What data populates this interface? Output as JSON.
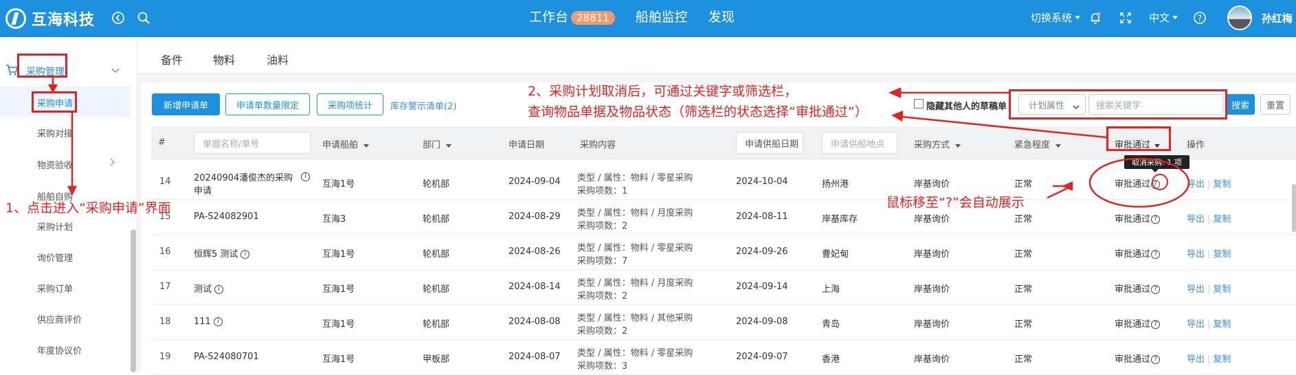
{
  "header": {
    "logo_text": "互海科技",
    "nav": {
      "workbench": "工作台",
      "workbench_badge": "28811",
      "ship_monitor": "船舶监控",
      "discover": "发现"
    },
    "switch_system": "切换系统",
    "language": "中文",
    "username": "孙红梅",
    "brand_color": "#1e90e0"
  },
  "sidebar": {
    "group_label": "采购管理",
    "items": [
      "采购申请",
      "采购对接",
      "物资验收",
      "船舶自购",
      "采购计划",
      "询价管理",
      "采购订单",
      "供应商评价",
      "年度协议价"
    ]
  },
  "tabs": [
    "备件",
    "物料",
    "油料"
  ],
  "active_tab": "物料",
  "toolbar": {
    "new_request": "新增申请单",
    "quantity_limit": "申请单数量限定",
    "item_stats": "采购项统计",
    "stock_alert_link": "库存警示清单(2)",
    "hide_drafts": "隐藏其他人的草稿单",
    "plan_attr_select": "计划属性",
    "search_placeholder": "搜索关键字",
    "search_btn": "搜索",
    "reset_btn": "重置"
  },
  "table": {
    "headers": {
      "index": "#",
      "name_placeholder": "单据名称/单号",
      "ship": "申请船舶",
      "dept": "部门",
      "date": "申请日期",
      "content": "采购内容",
      "supply_date_placeholder": "申请供船日期",
      "supply_place_placeholder": "申请供船地点",
      "method": "采购方式",
      "urgency": "紧急程度",
      "status": "审批通过",
      "ops": "操作"
    },
    "rows": [
      {
        "no": "14",
        "name1": "20240904潘俊杰的采购",
        "name2": "申请",
        "ship": "互海1号",
        "dept": "轮机部",
        "date": "2024-09-04",
        "content1": "类型 / 属性：物料 / 零星采购",
        "content2": "采购项数：1",
        "supply_date": "2024-10-04",
        "place": "扬州港",
        "method": "岸基询价",
        "urgency": "正常",
        "status": "审批通过"
      },
      {
        "no": "15",
        "name1": "PA-S24082901",
        "name2": "",
        "ship": "互海3",
        "dept": "轮机部",
        "date": "2024-08-29",
        "content1": "类型 / 属性：物料 / 月度采购",
        "content2": "采购项数：2",
        "supply_date": "2024-08-11",
        "place": "岸基库存",
        "method": "岸基询价",
        "urgency": "正常",
        "status": "审批通过"
      },
      {
        "no": "16",
        "name1": "恒辉5 测试",
        "name2": "",
        "ship": "互海1号",
        "dept": "轮机部",
        "date": "2024-08-26",
        "content1": "类型 / 属性：物料 / 零星采购",
        "content2": "采购项数：7",
        "supply_date": "2024-09-26",
        "place": "曹妃甸",
        "method": "岸基询价",
        "urgency": "正常",
        "status": "审批通过"
      },
      {
        "no": "17",
        "name1": "测试",
        "name2": "",
        "ship": "互海1号",
        "dept": "轮机部",
        "date": "2024-08-14",
        "content1": "类型 / 属性：物料 / 月度采购",
        "content2": "采购项数：2",
        "supply_date": "2024-09-14",
        "place": "上海",
        "method": "岸基询价",
        "urgency": "正常",
        "status": "审批通过"
      },
      {
        "no": "18",
        "name1": "111",
        "name2": "",
        "ship": "互海1号",
        "dept": "轮机部",
        "date": "2024-08-08",
        "content1": "类型 / 属性：物料 / 其他采购",
        "content2": "采购项数：2",
        "supply_date": "2024-09-08",
        "place": "青岛",
        "method": "岸基询价",
        "urgency": "正常",
        "status": "审批通过"
      },
      {
        "no": "19",
        "name1": "PA-S24080701",
        "name2": "",
        "ship": "互海1号",
        "dept": "甲板部",
        "date": "2024-08-07",
        "content1": "类型 / 属性：物料 / 零星采购",
        "content2": "采购项数：3",
        "supply_date": "2024-09-07",
        "place": "香港",
        "method": "岸基询价",
        "urgency": "正常",
        "status": "审批通过"
      }
    ],
    "op_export": "导出",
    "op_copy": "复制",
    "tooltip": "取消采购: 1 项"
  },
  "annotations": {
    "step1": "1、点击进入“采购申请”界面",
    "step2_line1": "2、采购计划取消后，可通过关键字或筛选栏，",
    "step2_line2": "查询物品单据及物品状态（筛选栏的状态选择“审批通过”）",
    "hover_note": "鼠标移至“?”会自动展示",
    "color": "#e52222"
  }
}
